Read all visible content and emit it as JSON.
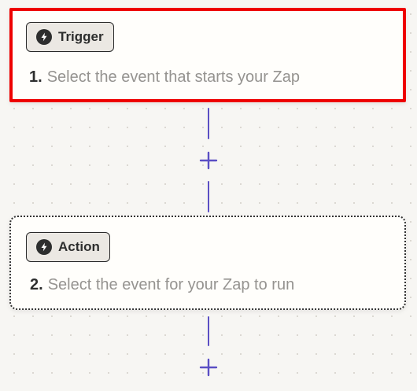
{
  "steps": [
    {
      "type_label": "Trigger",
      "number": "1.",
      "description": "Select the event that starts your Zap"
    },
    {
      "type_label": "Action",
      "number": "2.",
      "description": "Select the event for your Zap to run"
    }
  ],
  "icons": {
    "step_type": "lightning-bolt-icon",
    "add_step": "plus-icon"
  },
  "colors": {
    "selected_outline": "#ee0000",
    "connector": "#5b4fc4",
    "canvas": "#f7f6f3",
    "card": "#fffefb",
    "muted_text": "#959390"
  }
}
